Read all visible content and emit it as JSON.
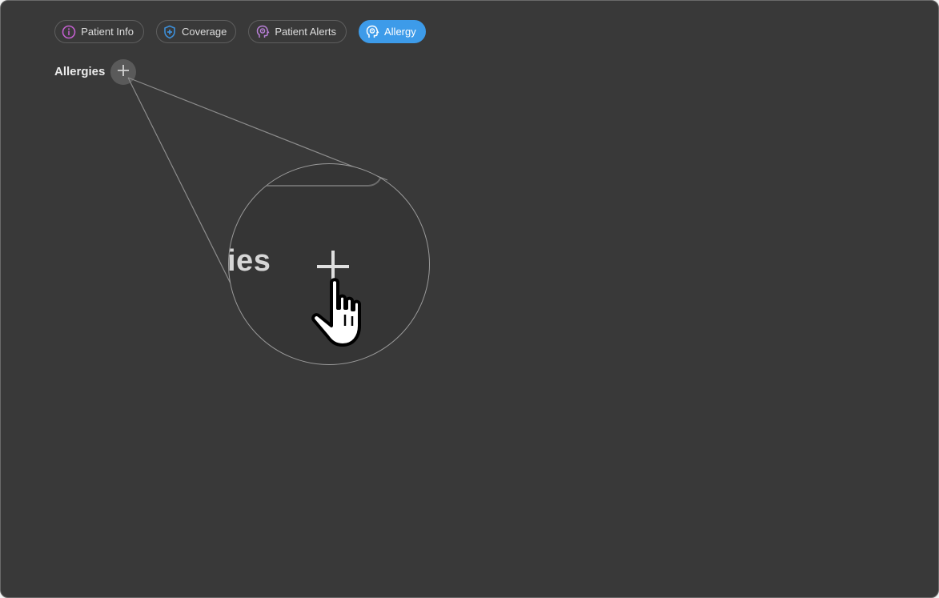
{
  "tabs": [
    {
      "label": "Patient Info",
      "icon": "info-icon",
      "icon_color": "#c35fcf",
      "active": false
    },
    {
      "label": "Coverage",
      "icon": "shield-plus-icon",
      "icon_color": "#3d8fd9",
      "active": false
    },
    {
      "label": "Patient Alerts",
      "icon": "alert-head-icon",
      "icon_color": "#b77fd6",
      "active": false
    },
    {
      "label": "Allergy",
      "icon": "allergy-head-icon",
      "icon_color": "#ffffff",
      "active": true
    }
  ],
  "section": {
    "title": "Allergies",
    "add_button_icon": "plus-icon"
  },
  "magnifier": {
    "text": "ies",
    "icons": [
      "plus-icon",
      "hand-pointer-icon"
    ]
  },
  "colors": {
    "background": "#393939",
    "accent": "#3d9be9",
    "button": "#5a5a5a"
  }
}
